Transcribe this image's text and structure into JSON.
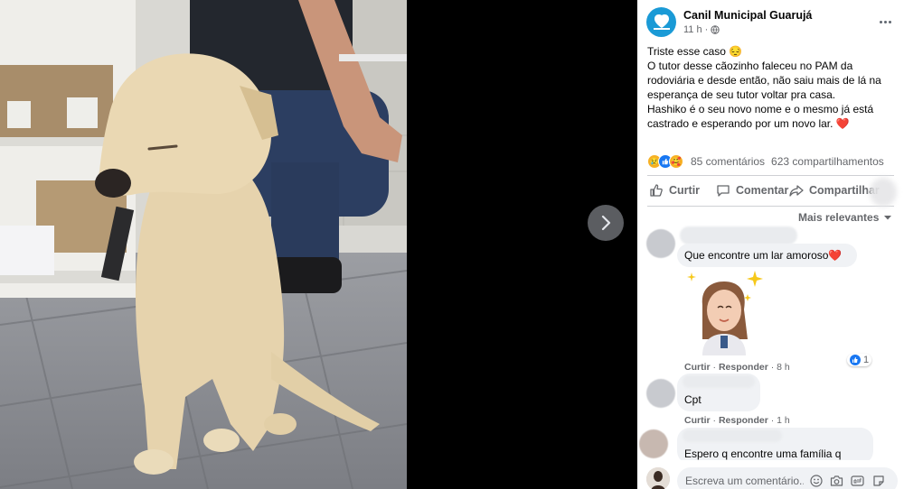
{
  "post": {
    "page_name": "Canil Municipal Guarujá",
    "time": "11 h ·",
    "text_lines": [
      "Triste esse caso 😔",
      "O tutor desse cãozinho faleceu no PAM da",
      "rodoviária e desde então, não saiu mais de lá na",
      "esperança de seu tutor voltar pra casa.",
      "Hashiko é o seu novo nome e o mesmo já está",
      "castrado e esperando por um novo lar. ❤️"
    ],
    "comments_count": "85 comentários",
    "shares_count": "623 compartilhamentos"
  },
  "actions": {
    "like": "Curtir",
    "comment": "Comentar",
    "share": "Compartilhar"
  },
  "sort_label": "Mais relevantes",
  "comments": [
    {
      "text": "Que encontre um lar amoroso❤️",
      "like_label": "Curtir",
      "reply_label": "Responder",
      "age": "8 h",
      "likes": "1"
    },
    {
      "text": "Cpt",
      "like_label": "Curtir",
      "reply_label": "Responder",
      "age": "1 h"
    },
    {
      "text": "Espero q encontre uma família q"
    }
  ],
  "composer": {
    "placeholder": "Escreva um comentário..."
  },
  "colors": {
    "accent": "#1877f2",
    "page_avatar": "#1a9ad6",
    "heart": "#e41e3f",
    "secondary_text": "#65676b"
  },
  "icons": [
    "next-arrow-icon",
    "globe-icon",
    "more-icon",
    "like-icon",
    "comment-icon",
    "share-icon",
    "chevron-down-icon",
    "emoji-icon",
    "camera-icon",
    "gif-icon",
    "sticker-icon"
  ]
}
